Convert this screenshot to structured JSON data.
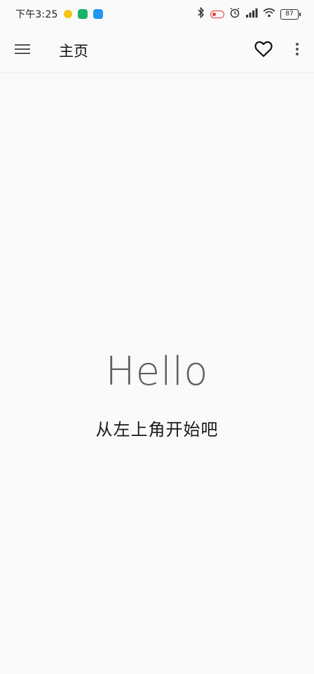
{
  "status_bar": {
    "time": "下午3:25",
    "battery": "87",
    "icons": [
      "notification-app-icon",
      "video-app-icon",
      "app-store-icon",
      "bluetooth-icon",
      "toggle-icon",
      "alarm-icon",
      "signal-icon",
      "wifi-icon",
      "battery-icon"
    ]
  },
  "toolbar": {
    "title": "主页",
    "menu_icon": "hamburger-menu-icon",
    "favorite_icon": "heart-outline-icon",
    "overflow_icon": "more-vert-icon"
  },
  "main": {
    "greeting": "Hello",
    "hint": "从左上角开始吧"
  },
  "colors": {
    "background": "#fafafa",
    "greeting_text": "#5f5f5f",
    "title_text": "#111111"
  }
}
